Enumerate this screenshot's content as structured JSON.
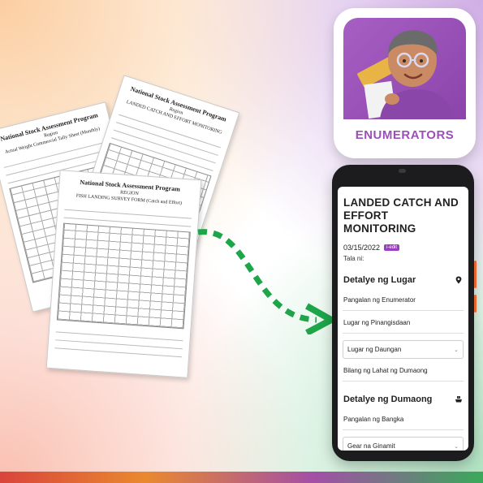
{
  "forms": {
    "back_left": {
      "title": "National Stock Assessment Program",
      "region": "Region",
      "subtitle": "Actual Weight Commercial Tally Sheet (Monthly)"
    },
    "back_right": {
      "title": "National Stock Assessment Program",
      "region": "Region",
      "subtitle": "LANDED CATCH AND EFFORT MONITORING"
    },
    "front": {
      "title": "National Stock Assessment Program",
      "region": "REGION",
      "subtitle": "FISH LANDING SURVEY FORM (Catch and Effort)"
    }
  },
  "app_icon": {
    "label": "ENUMERATORS",
    "accent": "#9b4fb8"
  },
  "phone": {
    "title": "LANDED CATCH AND EFFORT MONITORING",
    "date": "03/15/2022",
    "edit_badge": "i-edit",
    "tala": "Tala ni:",
    "section1": "Detalye ng Lugar",
    "field_enumerator": "Pangalan ng Enumerator",
    "field_fishing_ground": "Lugar ng Pinangisdaan",
    "select_landing": "Lugar ng Daungan",
    "field_total_landing": "Bilang ng Lahat ng Dumaong",
    "section2": "Detalye ng Dumaong",
    "field_boat_name": "Pangalan ng Bangka",
    "select_gear": "Gear na Ginamit"
  },
  "icons": {
    "location": "location-pin-icon",
    "boat": "boat-icon",
    "dropdown": "chevron-down-icon"
  },
  "colors": {
    "accent_purple": "#9b3fc0",
    "arrow_green": "#1ea54a"
  }
}
